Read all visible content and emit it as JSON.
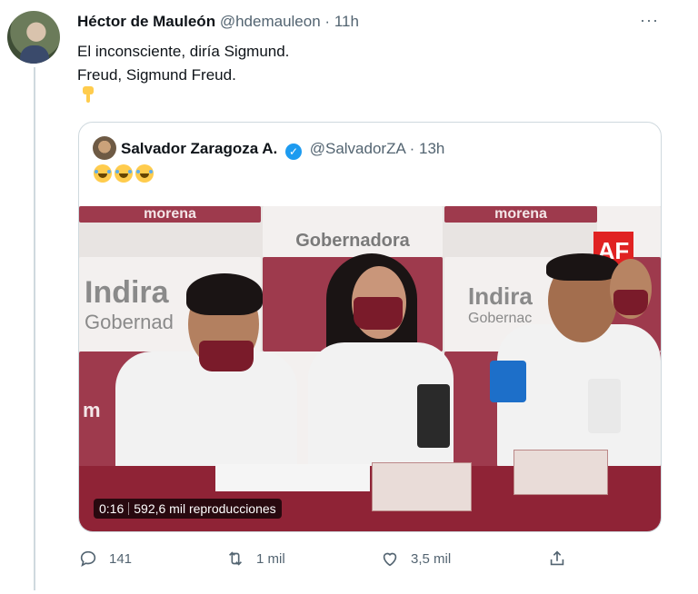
{
  "tweet": {
    "author_name": "Héctor de Mauleón",
    "author_handle": "@hdemauleon",
    "separator": "·",
    "time": "11h",
    "more_glyph": "···",
    "line1": "El inconsciente, diría Sigmund.",
    "line2": "Freud, Sigmund Freud.",
    "emoji_icon": "pointing-down-hand-icon"
  },
  "quoted": {
    "author_name": "Salvador Zaragoza A.",
    "verified": true,
    "author_handle": "@SalvadorZA",
    "separator": "·",
    "time": "13h",
    "emoji_icon": "tears-of-joy-icon",
    "emoji_count": 3,
    "video": {
      "duration": "0:16",
      "views": "592,6 mil reproducciones",
      "watermark": "AF",
      "banners": {
        "morena": "morena",
        "indira": "Indira",
        "gobernadora": "Gobernadora",
        "gobernadora_short": "Gobernad",
        "gobernadora_alt": "Gobernac",
        "mo": "mo",
        "m": "m"
      }
    }
  },
  "actions": {
    "replies": "141",
    "retweets": "1 mil",
    "likes": "3,5 mil"
  },
  "colors": {
    "accent": "#1d9bf0",
    "muted": "#536471",
    "border": "#cfd9de",
    "banner_red": "#9e3a4d",
    "table_red": "#8f2336"
  }
}
